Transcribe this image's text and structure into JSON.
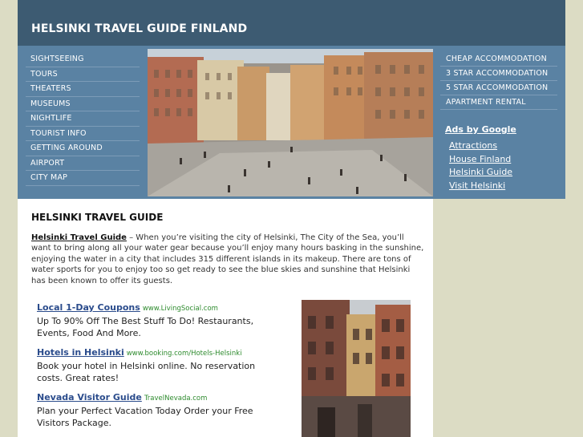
{
  "header": {
    "title": "HELSINKI TRAVEL GUIDE FINLAND"
  },
  "left_nav": [
    "SIGHTSEEING",
    "TOURS",
    "THEATERS",
    "MUSEUMS",
    "NIGHTLIFE",
    "TOURIST INFO",
    "GETTING AROUND",
    "AIRPORT",
    "CITY MAP"
  ],
  "right_nav": [
    "CHEAP ACCOMMODATION",
    "3 STAR ACCOMMODATION",
    "5 STAR ACCOMMODATION",
    "APARTMENT RENTAL"
  ],
  "ads_by_google": "Ads by Google",
  "side_links": [
    "Attractions",
    "House Finland",
    "Helsinki Guide",
    "Visit Helsinki"
  ],
  "content": {
    "title": "HELSINKI TRAVEL GUIDE",
    "intro_link": "Helsinki Travel Guide",
    "intro_text": " – When you’re visiting the city of Helsinki, The City of the Sea, you’ll want to bring along all your water gear because you’ll enjoy many hours basking in the sunshine, enjoying the water in a city that includes 315 different islands in its makeup. There are tons of water sports for you to enjoy too so get ready to see the blue skies and sunshine that Helsinki has been known to offer its guests."
  },
  "ads": [
    {
      "title": "Local 1-Day Coupons",
      "url": "www.LivingSocial.com",
      "text": "Up To 90% Off The Best Stuff To Do! Restaurants, Events, Food And More."
    },
    {
      "title": "Hotels in Helsinki",
      "url": "www.booking.com/Hotels-Helsinki",
      "text": "Book your hotel in Helsinki online. No reservation costs. Great rates!"
    },
    {
      "title": "Nevada Visitor Guide",
      "url": "TravelNevada.com",
      "text": "Plan your Perfect Vacation Today Order your Free Visitors Package."
    }
  ],
  "colors": {
    "header_bg": "#3d5b72",
    "band_bg": "#5a82a3",
    "page_bg": "#dcdcc4",
    "ad_title": "#2b4c8c",
    "ad_url": "#2e8b2e"
  }
}
